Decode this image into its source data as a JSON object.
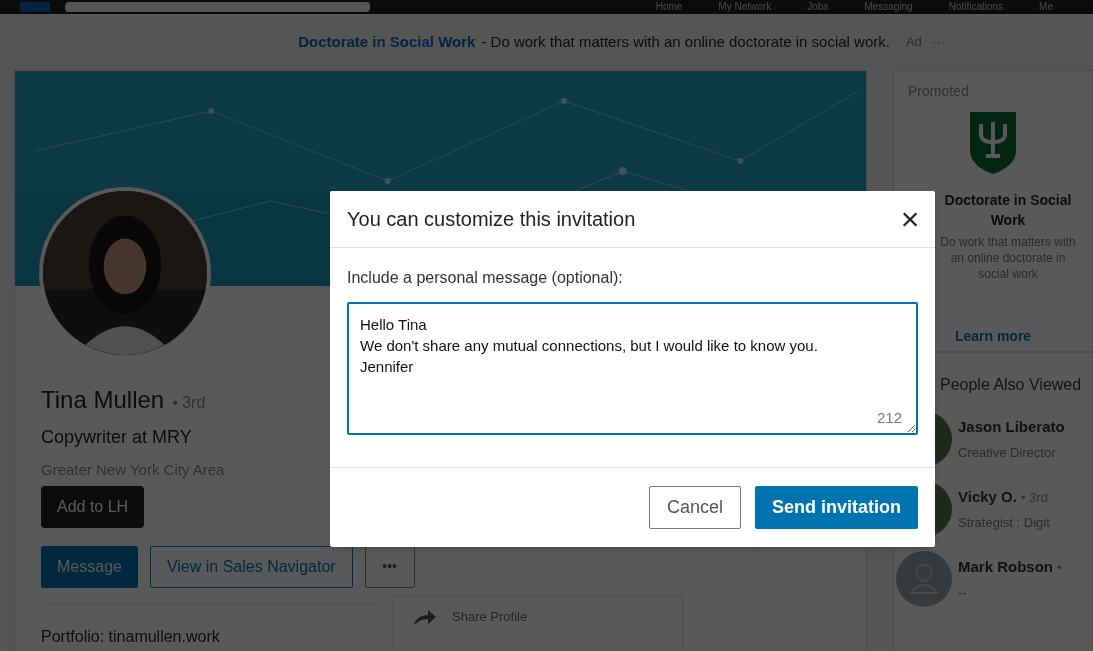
{
  "top_nav": {
    "items": [
      "Home",
      "My Network",
      "Jobs",
      "Messaging",
      "Notifications",
      "Me"
    ]
  },
  "ad_banner": {
    "link": "Doctorate in Social Work",
    "text": "- Do work that matters with an online doctorate in social work.",
    "label": "Ad",
    "menu": "···"
  },
  "profile": {
    "name": "Tina Mullen",
    "degree": "• 3rd",
    "headline": "Copywriter at MRY",
    "location": "Greater New York City Area",
    "buttons": [
      {
        "label": "Add to LH",
        "kind": "dark"
      },
      {
        "label": "Message",
        "kind": "primary"
      },
      {
        "label": "View in Sales Navigator",
        "kind": "outline"
      },
      {
        "label": "•••",
        "kind": "more"
      }
    ],
    "portfolio": "Portfolio: tinamullen.work",
    "menu": [
      "Share Profile"
    ]
  },
  "promoted": {
    "label": "Promoted",
    "title": "Doctorate in Social Work",
    "text": "Do work that matters with an online doctorate in social work",
    "link": "Learn more"
  },
  "people_also_viewed": {
    "title": "People Also Viewed",
    "people": [
      {
        "name": "Jason Liberato",
        "headline": "Creative Director"
      },
      {
        "name": "Vicky O.",
        "degree": "• 3rd",
        "headline": "Strategist : Digit"
      },
      {
        "name": "Mark Robson",
        "degree": "•",
        "headline": "--",
        "kind": "placeholder"
      }
    ]
  },
  "dialog": {
    "title": "You can customize this invitation",
    "close": "×",
    "prompt": "Include a personal message (optional):",
    "message": "Hello Tina\nWe don't share any mutual connections, but I would like to know you.\nJennifer",
    "counter": "212",
    "buttons": [
      {
        "label": "Cancel",
        "kind": "secondary"
      },
      {
        "label": "Send invitation",
        "kind": "primary"
      }
    ]
  }
}
